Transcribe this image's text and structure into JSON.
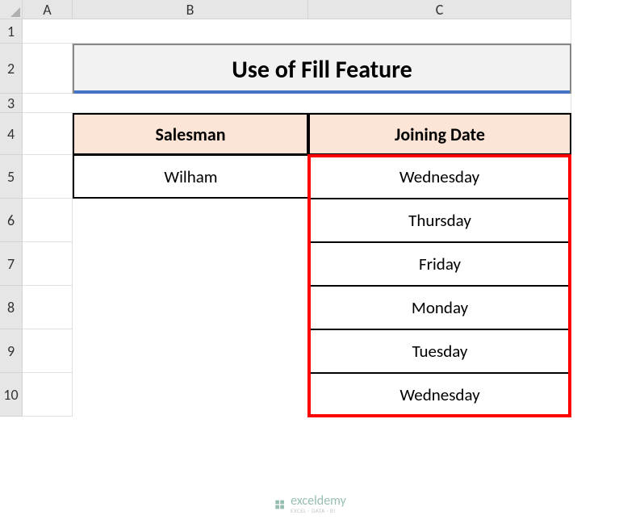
{
  "columns": [
    "A",
    "B",
    "C"
  ],
  "rows": [
    "1",
    "2",
    "3",
    "4",
    "5",
    "6",
    "7",
    "8",
    "9",
    "10"
  ],
  "title": "Use of Fill Feature",
  "table": {
    "headers": {
      "salesman": "Salesman",
      "joining_date": "Joining Date"
    },
    "salesman_value": "Wilham",
    "dates": [
      "Wednesday",
      "Thursday",
      "Friday",
      "Monday",
      "Tuesday",
      "Wednesday"
    ]
  },
  "watermark": {
    "name": "exceldemy",
    "tagline": "EXCEL · DATA · BI"
  }
}
